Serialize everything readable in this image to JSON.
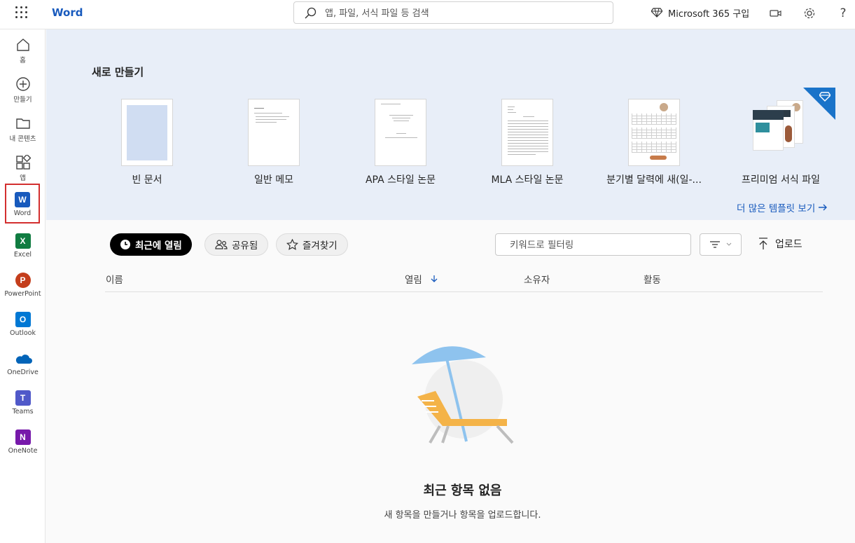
{
  "app": {
    "title": "Word"
  },
  "search": {
    "placeholder": "앱, 파일, 서식 파일 등 검색"
  },
  "header": {
    "m365_label": "Microsoft 365 구입"
  },
  "rail": {
    "items": [
      {
        "label": "홈",
        "icon": "home-icon"
      },
      {
        "label": "만들기",
        "icon": "plus-circle-icon"
      },
      {
        "label": "내 콘텐츠",
        "icon": "folder-icon"
      },
      {
        "label": "앱",
        "icon": "apps-icon"
      },
      {
        "label": "Word",
        "icon": "word-icon",
        "color": "#185abd"
      },
      {
        "label": "Excel",
        "icon": "excel-icon",
        "color": "#107c41"
      },
      {
        "label": "PowerPoint",
        "icon": "powerpoint-icon",
        "color": "#c43e1c"
      },
      {
        "label": "Outlook",
        "icon": "outlook-icon",
        "color": "#0078d4"
      },
      {
        "label": "OneDrive",
        "icon": "onedrive-icon",
        "color": "#0364b8"
      },
      {
        "label": "Teams",
        "icon": "teams-icon",
        "color": "#5059c9"
      },
      {
        "label": "OneNote",
        "icon": "onenote-icon",
        "color": "#7719aa"
      }
    ]
  },
  "create": {
    "title": "새로 만들기",
    "templates": [
      {
        "name": "빈 문서"
      },
      {
        "name": "일반 메모"
      },
      {
        "name": "APA 스타일 논문"
      },
      {
        "name": "MLA 스타일 논문"
      },
      {
        "name": "분기별 달력에 새(일-..."
      },
      {
        "name": "프리미엄 서식 파일"
      }
    ],
    "more_link": "더 많은 템플릿 보기"
  },
  "filters": {
    "recent": "최근에 열림",
    "shared": "공유됨",
    "favorites": "즐겨찾기",
    "keyword_placeholder": "키워드로 필터링",
    "upload": "업로드"
  },
  "table": {
    "col_name": "이름",
    "col_opened": "열림",
    "col_owner": "소유자",
    "col_activity": "활동"
  },
  "empty": {
    "title": "최근 항목 없음",
    "subtitle": "새 항목을 만들거나 항목을 업로드합니다."
  },
  "colors": {
    "accent": "#185abd",
    "hero_bg": "#e8eef8",
    "premium": "#1a73c9"
  }
}
